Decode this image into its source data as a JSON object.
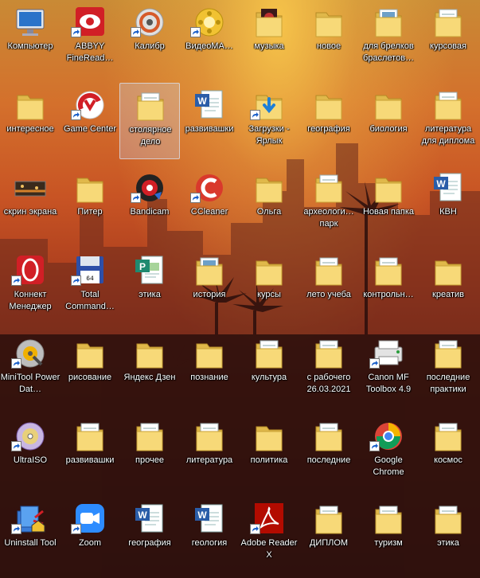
{
  "desktop": {
    "icons": [
      {
        "label": "Компьютер",
        "icon": "computer-icon",
        "shortcut": false
      },
      {
        "label": "ABBYY FineRead…",
        "icon": "abbyy-finereader-icon",
        "shortcut": true
      },
      {
        "label": "Калибр",
        "icon": "calibre-icon",
        "shortcut": true
      },
      {
        "label": "ВидеоМА…",
        "icon": "videomaster-icon",
        "shortcut": true
      },
      {
        "label": "музыка",
        "icon": "music-folder-icon",
        "shortcut": false
      },
      {
        "label": "новое",
        "icon": "folder-icon",
        "shortcut": false
      },
      {
        "label": "для брелков браслетов…",
        "icon": "folder-with-images-icon",
        "shortcut": false
      },
      {
        "label": "курсовая",
        "icon": "folder-with-papers-icon",
        "shortcut": false
      },
      {
        "label": "интересное",
        "icon": "folder-icon",
        "shortcut": false
      },
      {
        "label": "Game Center",
        "icon": "game-center-icon",
        "shortcut": true
      },
      {
        "label": "столярное дело",
        "icon": "folder-with-papers-icon",
        "shortcut": false
      },
      {
        "label": "развивашки",
        "icon": "word-document-icon",
        "shortcut": false
      },
      {
        "label": "Загрузки - Ярлык",
        "icon": "downloads-folder-icon",
        "shortcut": true
      },
      {
        "label": "география",
        "icon": "folder-icon",
        "shortcut": false
      },
      {
        "label": "биология",
        "icon": "folder-icon",
        "shortcut": false
      },
      {
        "label": "литература для диплома",
        "icon": "folder-with-papers-icon",
        "shortcut": false
      },
      {
        "label": "скрин экрана",
        "icon": "screenshot-image-icon",
        "shortcut": false
      },
      {
        "label": "Питер",
        "icon": "folder-icon",
        "shortcut": false
      },
      {
        "label": "Bandicam",
        "icon": "bandicam-icon",
        "shortcut": true
      },
      {
        "label": "CCleaner",
        "icon": "ccleaner-icon",
        "shortcut": true
      },
      {
        "label": "Ольга",
        "icon": "folder-icon",
        "shortcut": false
      },
      {
        "label": "археологи… парк",
        "icon": "folder-with-papers-icon",
        "shortcut": false
      },
      {
        "label": "Новая папка",
        "icon": "folder-icon",
        "shortcut": false
      },
      {
        "label": "КВН",
        "icon": "word-document-icon",
        "shortcut": false
      },
      {
        "label": "Коннект Менеджер",
        "icon": "connect-manager-icon",
        "shortcut": true
      },
      {
        "label": "Total Command…",
        "icon": "total-commander-icon",
        "shortcut": true
      },
      {
        "label": "этика",
        "icon": "publisher-document-icon",
        "shortcut": false
      },
      {
        "label": "история",
        "icon": "folder-with-images-icon",
        "shortcut": false
      },
      {
        "label": "курсы",
        "icon": "folder-icon",
        "shortcut": false
      },
      {
        "label": "лето учеба",
        "icon": "folder-with-papers-icon",
        "shortcut": false
      },
      {
        "label": "контрольн…",
        "icon": "folder-with-papers-icon",
        "shortcut": false
      },
      {
        "label": "креатив",
        "icon": "folder-icon",
        "shortcut": false
      },
      {
        "label": "MiniTool Power Dat…",
        "icon": "minitool-icon",
        "shortcut": true
      },
      {
        "label": "рисование",
        "icon": "folder-icon",
        "shortcut": false
      },
      {
        "label": "Яндекс Дзен",
        "icon": "folder-icon",
        "shortcut": false
      },
      {
        "label": "познание",
        "icon": "folder-icon",
        "shortcut": false
      },
      {
        "label": "культура",
        "icon": "folder-with-papers-icon",
        "shortcut": false
      },
      {
        "label": "с рабочего 26.03.2021",
        "icon": "folder-with-papers-icon",
        "shortcut": false
      },
      {
        "label": "Canon MF Toolbox 4.9",
        "icon": "canon-toolbox-icon",
        "shortcut": true
      },
      {
        "label": "последние практики",
        "icon": "folder-with-papers-icon",
        "shortcut": false
      },
      {
        "label": "UltraISO",
        "icon": "ultraiso-icon",
        "shortcut": true
      },
      {
        "label": "развивашки",
        "icon": "folder-with-papers-icon",
        "shortcut": false
      },
      {
        "label": "прочее",
        "icon": "folder-with-papers-icon",
        "shortcut": false
      },
      {
        "label": "литература",
        "icon": "folder-with-papers-icon",
        "shortcut": false
      },
      {
        "label": "политика",
        "icon": "folder-icon",
        "shortcut": false
      },
      {
        "label": "последние",
        "icon": "folder-with-papers-icon",
        "shortcut": false
      },
      {
        "label": "Google Chrome",
        "icon": "chrome-icon",
        "shortcut": true
      },
      {
        "label": "космос",
        "icon": "folder-with-papers-icon",
        "shortcut": false
      },
      {
        "label": "Uninstall Tool",
        "icon": "uninstall-tool-icon",
        "shortcut": true
      },
      {
        "label": "Zoom",
        "icon": "zoom-icon",
        "shortcut": true
      },
      {
        "label": "география",
        "icon": "word-document-icon",
        "shortcut": false
      },
      {
        "label": "геология",
        "icon": "word-document-icon",
        "shortcut": false
      },
      {
        "label": "Adobe Reader X",
        "icon": "adobe-reader-icon",
        "shortcut": true
      },
      {
        "label": "ДИПЛОМ",
        "icon": "folder-with-papers-icon",
        "shortcut": false
      },
      {
        "label": "туризм",
        "icon": "folder-with-papers-icon",
        "shortcut": false
      },
      {
        "label": "этика",
        "icon": "folder-with-papers-icon",
        "shortcut": false
      }
    ],
    "selected_index": 10
  }
}
